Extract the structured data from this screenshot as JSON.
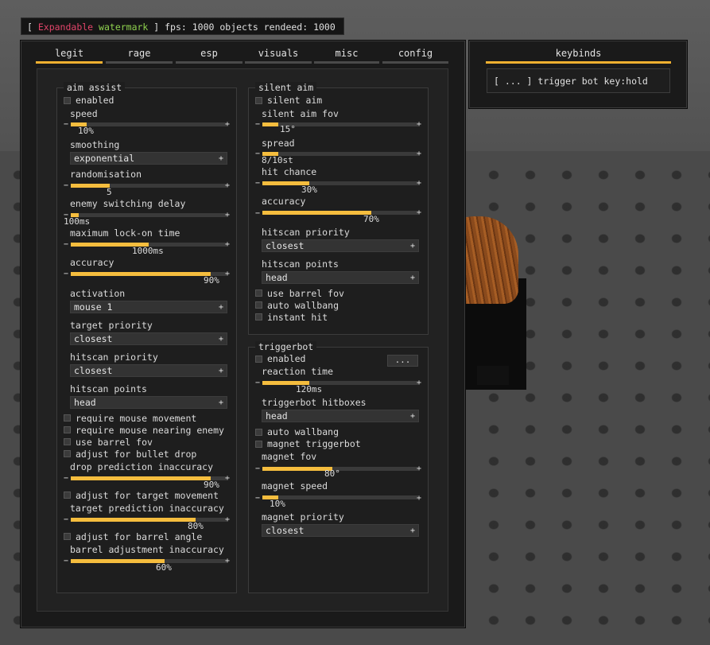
{
  "watermark": {
    "open": "[ ",
    "red": "Expandable",
    "space": " ",
    "green": "watermark",
    "rest": " ] fps: 1000 objects rendeed: 1000"
  },
  "tabs": [
    "legit",
    "rage",
    "esp",
    "visuals",
    "misc",
    "config"
  ],
  "keybinds": {
    "title": "keybinds",
    "entry": "[ ... ] trigger bot key:hold"
  },
  "aim_assist": {
    "title": "aim assist",
    "enabled": "enabled",
    "speed": {
      "label": "speed",
      "value": "10%",
      "fraction": 0.1
    },
    "smoothing": {
      "label": "smoothing",
      "value": "exponential"
    },
    "randomisation": {
      "label": "randomisation",
      "value": "5",
      "fraction": 0.25
    },
    "enemy_switching_delay": {
      "label": "enemy switching delay",
      "value": "100ms",
      "fraction": 0.05
    },
    "max_lockon": {
      "label": "maximum lock-on time",
      "value": "1000ms",
      "fraction": 0.5
    },
    "accuracy": {
      "label": "accuracy",
      "value": "90%",
      "fraction": 0.9
    },
    "activation": {
      "label": "activation",
      "value": "mouse 1"
    },
    "target_priority": {
      "label": "target priority",
      "value": "closest"
    },
    "hitscan_priority": {
      "label": "hitscan priority",
      "value": "closest"
    },
    "hitscan_points": {
      "label": "hitscan points",
      "value": "head"
    },
    "require_mouse_movement": "require mouse movement",
    "require_mouse_nearing": "require mouse nearing enemy",
    "use_barrel_fov": "use barrel fov",
    "adjust_bullet_drop": "adjust for bullet drop",
    "drop_prediction": {
      "label": "drop prediction inaccuracy",
      "value": "90%",
      "fraction": 0.9
    },
    "adjust_target_movement": "adjust for target movement",
    "target_prediction": {
      "label": "target prediction inaccuracy",
      "value": "80%",
      "fraction": 0.8
    },
    "adjust_barrel_angle": "adjust for barrel angle",
    "barrel_adjustment": {
      "label": "barrel adjustment inaccuracy",
      "value": "60%",
      "fraction": 0.6
    }
  },
  "silent_aim": {
    "title": "silent aim",
    "enabled": "silent aim",
    "fov": {
      "label": "silent aim fov",
      "value": "15°",
      "fraction": 0.1
    },
    "spread": {
      "label": "spread",
      "value": "8/10st",
      "fraction": 0.1
    },
    "hit_chance": {
      "label": "hit chance",
      "value": "30%",
      "fraction": 0.3
    },
    "accuracy": {
      "label": "accuracy",
      "value": "70%",
      "fraction": 0.7
    },
    "hitscan_priority": {
      "label": "hitscan priority",
      "value": "closest"
    },
    "hitscan_points": {
      "label": "hitscan points",
      "value": "head"
    },
    "use_barrel_fov": "use barrel fov",
    "auto_wallbang": "auto wallbang",
    "instant_hit": "instant hit"
  },
  "triggerbot": {
    "title": "triggerbot",
    "enabled": "enabled",
    "key_button": "...",
    "reaction_time": {
      "label": "reaction time",
      "value": "120ms",
      "fraction": 0.3
    },
    "hitboxes": {
      "label": "triggerbot hitboxes",
      "value": "head"
    },
    "auto_wallbang": "auto wallbang",
    "magnet": "magnet triggerbot",
    "magnet_fov": {
      "label": "magnet fov",
      "value": "80°",
      "fraction": 0.45
    },
    "magnet_speed": {
      "label": "magnet speed",
      "value": "10%",
      "fraction": 0.1
    },
    "magnet_priority": {
      "label": "magnet priority",
      "value": "closest"
    }
  }
}
